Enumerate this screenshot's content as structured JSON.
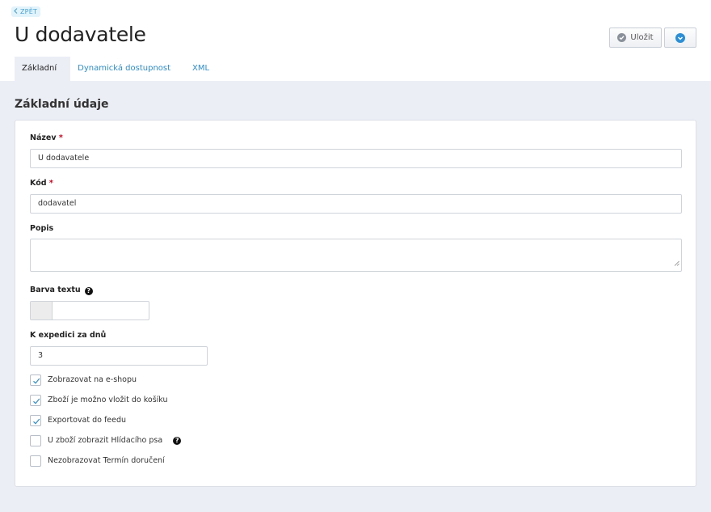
{
  "header": {
    "back_label": "ZPĚT",
    "title": "U dodavatele",
    "save_label": "Uložit"
  },
  "tabs": [
    {
      "label": "Základní",
      "active": true
    },
    {
      "label": "Dynamická dostupnost",
      "active": false
    },
    {
      "label": "XML",
      "active": false
    }
  ],
  "section": {
    "title": "Základní údaje"
  },
  "form": {
    "name": {
      "label": "Název",
      "required_mark": "*",
      "value": "U dodavatele"
    },
    "code": {
      "label": "Kód",
      "required_mark": "*",
      "value": "dodavatel"
    },
    "description": {
      "label": "Popis",
      "value": ""
    },
    "text_color": {
      "label": "Barva textu",
      "help": "?",
      "swatch_color": "#ececec"
    },
    "ship_days": {
      "label": "K expedici za dnů",
      "value": "3"
    },
    "checkboxes": [
      {
        "label": "Zobrazovat na e-shopu",
        "checked": true
      },
      {
        "label": "Zboží je možno vložit do košíku",
        "checked": true
      },
      {
        "label": "Exportovat do feedu",
        "checked": true
      },
      {
        "label": "U zboží zobrazit Hlídacího psa",
        "checked": false,
        "help": "?"
      },
      {
        "label": "Nezobrazovat Termín doručení",
        "checked": false
      }
    ]
  },
  "colors": {
    "accent": "#2b8ecf",
    "background": "#ebeef5",
    "required": "#d0021b"
  }
}
